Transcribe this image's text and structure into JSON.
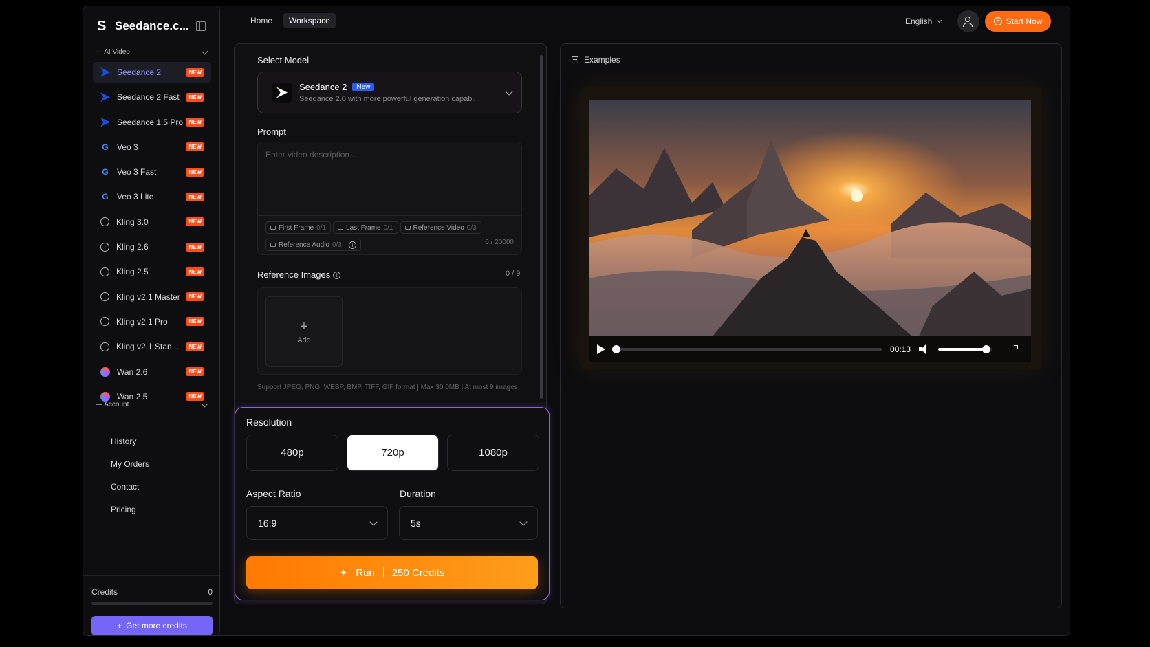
{
  "brand": {
    "name": "Seedance.c...",
    "logo_icon": "seedance-logo-icon"
  },
  "sidebar": {
    "ai_video_section": "— AI Video",
    "items": [
      {
        "label": "Seedance 2",
        "badge": "NEW",
        "icon": "seedance-icon",
        "active": true
      },
      {
        "label": "Seedance 2 Fast",
        "badge": "NEW",
        "icon": "seedance-icon"
      },
      {
        "label": "Seedance 1.5 Pro",
        "badge": "NEW",
        "icon": "seedance-icon"
      },
      {
        "label": "Veo 3",
        "badge": "NEW",
        "icon": "google-icon"
      },
      {
        "label": "Veo 3 Fast",
        "badge": "NEW",
        "icon": "google-icon"
      },
      {
        "label": "Veo 3 Lite",
        "badge": "NEW",
        "icon": "google-icon"
      },
      {
        "label": "Kling 3.0",
        "badge": "NEW",
        "icon": "kling-icon"
      },
      {
        "label": "Kling 2.6",
        "badge": "NEW",
        "icon": "kling-icon"
      },
      {
        "label": "Kling 2.5",
        "badge": "NEW",
        "icon": "kling-icon"
      },
      {
        "label": "Kling v2.1 Master",
        "badge": "NEW",
        "icon": "kling-icon"
      },
      {
        "label": "Kling v2.1 Pro",
        "badge": "NEW",
        "icon": "kling-icon"
      },
      {
        "label": "Kling v2.1 Stan...",
        "badge": "NEW",
        "icon": "kling-icon"
      },
      {
        "label": "Wan 2.6",
        "badge": "NEW",
        "icon": "wan-icon"
      },
      {
        "label": "Wan 2.5",
        "badge": "NEW",
        "icon": "wan-icon"
      }
    ],
    "account_section": "— Account",
    "account_items": [
      "History",
      "My Orders",
      "Contact",
      "Pricing"
    ],
    "credits_label": "Credits",
    "credits_value": "0",
    "credits_fraction": 0,
    "get_more_label": "Get more credits"
  },
  "topbar": {
    "tabs": [
      {
        "label": "Home",
        "active": false
      },
      {
        "label": "Workspace",
        "active": true
      }
    ],
    "language": "English",
    "start_label": "Start Now"
  },
  "form": {
    "select_model_label": "Select Model",
    "model": {
      "name": "Seedance 2",
      "badge": "New",
      "description": "Seedance 2.0 with more powerful generation capabi..."
    },
    "prompt_label": "Prompt",
    "prompt_placeholder": "Enter video description...",
    "chips": [
      {
        "label": "First Frame",
        "count": "0/1"
      },
      {
        "label": "Last Frame",
        "count": "0/1"
      },
      {
        "label": "Reference Video",
        "count": "0/3"
      },
      {
        "label": "Reference Audio",
        "count": "0/3"
      }
    ],
    "char_count": "0 / 20000",
    "ref_images_label": "Reference Images",
    "ref_images_count": "0 / 9",
    "add_label": "Add",
    "support_text": "Support JPEG, PNG, WEBP, BMP, TIFF, GIF format | Max 30.0MB | At most 9 images",
    "resolution_label": "Resolution",
    "resolutions": [
      {
        "label": "480p"
      },
      {
        "label": "720p",
        "selected": true
      },
      {
        "label": "1080p"
      }
    ],
    "aspect_label": "Aspect Ratio",
    "aspect_value": "16:9",
    "duration_label": "Duration",
    "duration_value": "5s",
    "run_label": "Run",
    "run_cost": "250 Credits"
  },
  "examples": {
    "title": "Examples",
    "video_time": "00:13",
    "progress_fraction": 0.0,
    "volume_fraction": 0.9
  },
  "colors": {
    "accent_orange": "#ff6a13",
    "accent_purple": "#7566f5",
    "badge_red": "#ff4d1a"
  }
}
